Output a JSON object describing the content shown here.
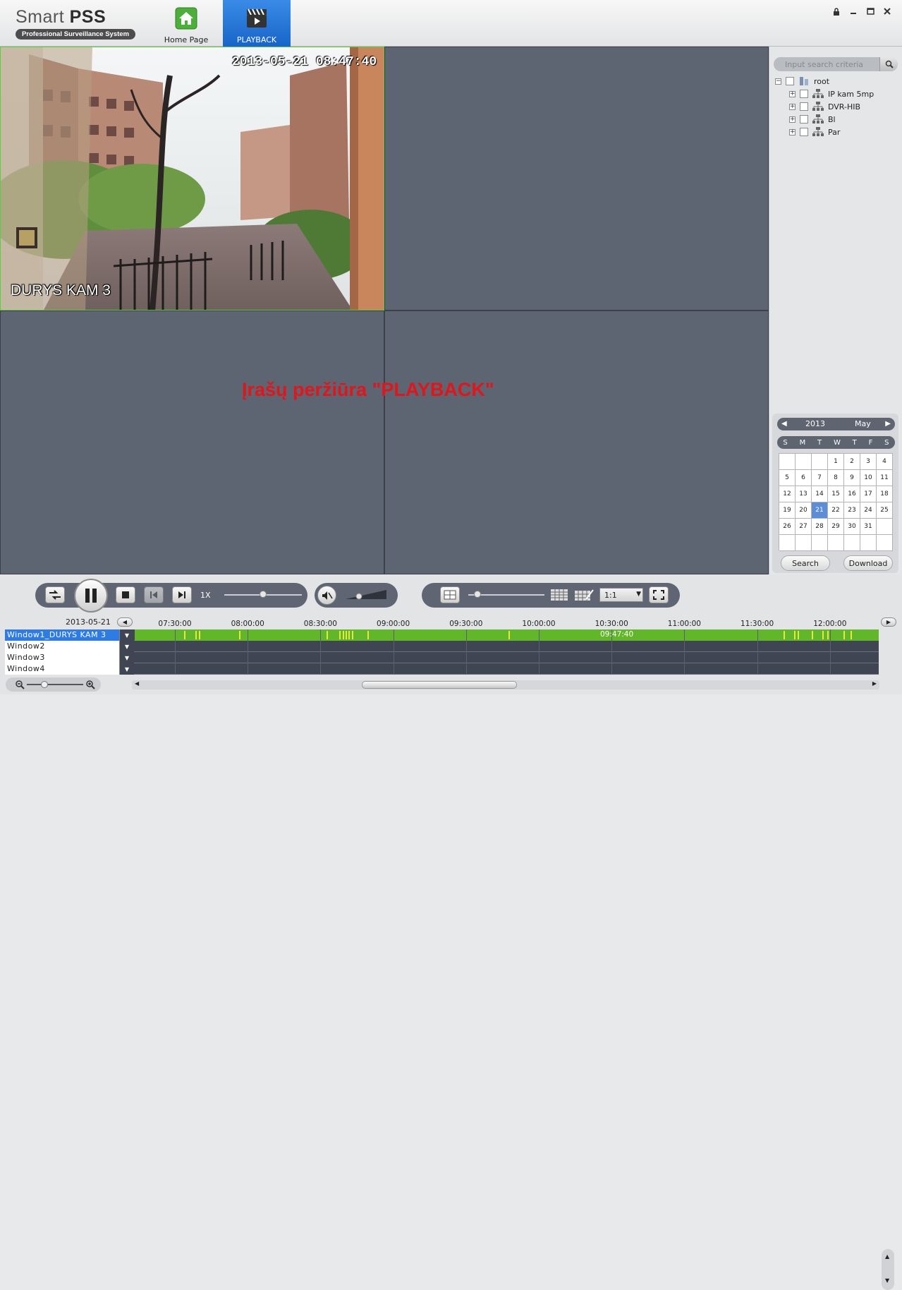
{
  "app": {
    "name_light": "Smart ",
    "name_bold": "PSS",
    "subtitle": "Professional Surveillance System"
  },
  "nav": {
    "home_label": "Home Page",
    "playback_label": "PLAYBACK"
  },
  "window_controls": [
    "lock-icon",
    "minimize-icon",
    "maximize-icon",
    "close-icon"
  ],
  "video": {
    "timestamp": "2013-05-21  08:47:40",
    "camera_name": "DURYS KAM 3",
    "overlay_text": "Įrašų peržiūra \"PLAYBACK\"",
    "overlay_color": "#e3141a",
    "active_border_color": "#5ccd3c"
  },
  "search": {
    "placeholder": "Input search criteria"
  },
  "device_tree": {
    "root": "root",
    "children": [
      "IP kam 5mp",
      "DVR-HIB",
      "Bl",
      "Par"
    ]
  },
  "calendar": {
    "year": "2013",
    "month": "May",
    "weekdays": [
      "S",
      "M",
      "T",
      "W",
      "T",
      "F",
      "S"
    ],
    "days": [
      "",
      "",
      "",
      "1",
      "2",
      "3",
      "4",
      "5",
      "6",
      "7",
      "8",
      "9",
      "10",
      "11",
      "12",
      "13",
      "14",
      "15",
      "16",
      "17",
      "18",
      "19",
      "20",
      "21",
      "22",
      "23",
      "24",
      "25",
      "26",
      "27",
      "28",
      "29",
      "30",
      "31",
      "",
      "",
      "",
      "",
      "",
      "",
      "",
      ""
    ],
    "selected_day": "21",
    "search_label": "Search",
    "download_label": "Download"
  },
  "controls": {
    "speed": "1X",
    "speed_slider": 0.5,
    "volume_level": 0.3,
    "aspect_ratio": "1:1"
  },
  "timeline": {
    "date": "2013-05-21",
    "ticks": [
      "07:30:00",
      "08:00:00",
      "08:30:00",
      "09:00:00",
      "09:30:00",
      "10:00:00",
      "10:30:00",
      "11:00:00",
      "11:30:00",
      "12:00:00"
    ],
    "play_time": "09:47:40",
    "tracks": [
      "Window1_DURYS KAM 3",
      "Window2",
      "Window3",
      "Window4"
    ],
    "recording_color": "#62b629",
    "event_color": "#e8e83a"
  }
}
